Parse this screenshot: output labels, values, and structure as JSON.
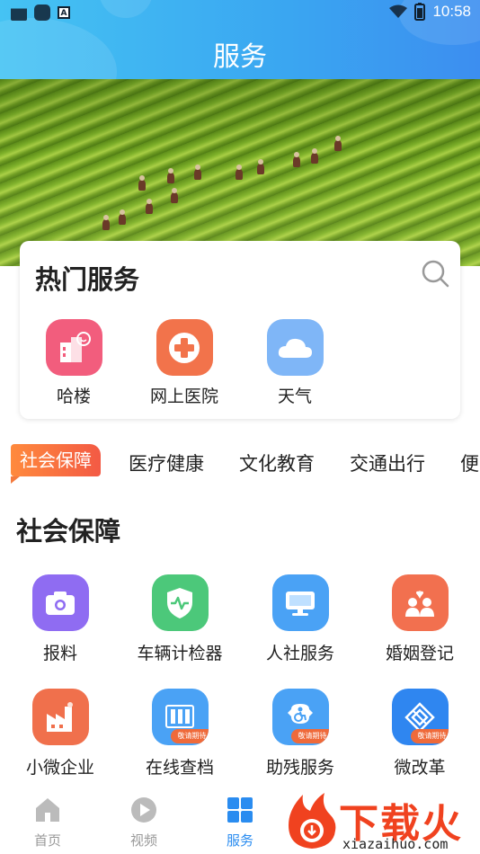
{
  "status_bar": {
    "time": "10:58"
  },
  "header": {
    "title": "服务"
  },
  "hot_services": {
    "title": "热门服务",
    "items": [
      {
        "label": "哈楼",
        "icon": "building-smile-icon",
        "color": "#f25d7d"
      },
      {
        "label": "网上医院",
        "icon": "medical-cross-icon",
        "color": "#f2734b"
      },
      {
        "label": "天气",
        "icon": "cloud-icon",
        "color": "#7fb6f7"
      }
    ]
  },
  "tabs": {
    "active": "社会保障",
    "items": [
      "社会保障",
      "医疗健康",
      "文化教育",
      "交通出行",
      "便"
    ]
  },
  "section": {
    "title": "社会保障",
    "items": [
      {
        "label": "报料",
        "icon": "camera-icon",
        "color": "#8f6cf2",
        "badge": ""
      },
      {
        "label": "车辆计检器",
        "icon": "shield-pulse-icon",
        "color": "#4cc87a",
        "badge": ""
      },
      {
        "label": "人社服务",
        "icon": "monitor-icon",
        "color": "#4aa2f5",
        "badge": ""
      },
      {
        "label": "婚姻登记",
        "icon": "couple-heart-icon",
        "color": "#f2704f",
        "badge": ""
      },
      {
        "label": "小微企业",
        "icon": "factory-icon",
        "color": "#f0704c",
        "badge": ""
      },
      {
        "label": "在线查档",
        "icon": "archive-icon",
        "color": "#4aa2f5",
        "badge": "敬请期待"
      },
      {
        "label": "助残服务",
        "icon": "wheelchair-icon",
        "color": "#4aa2f5",
        "badge": "敬请期待"
      },
      {
        "label": "微改革",
        "icon": "diamond-icon",
        "color": "#2f86f0",
        "badge": "敬请期待"
      }
    ]
  },
  "bottom_nav": {
    "items": [
      {
        "label": "首页",
        "icon": "home-icon",
        "active": false
      },
      {
        "label": "视频",
        "icon": "play-icon",
        "active": false
      },
      {
        "label": "服务",
        "icon": "grid-icon",
        "active": true
      }
    ]
  },
  "watermark": {
    "brand": "下载火",
    "url": "xiazaihuo.com"
  },
  "colors": {
    "accent": "#2a8cf0",
    "tab_active": "#f35a44"
  }
}
